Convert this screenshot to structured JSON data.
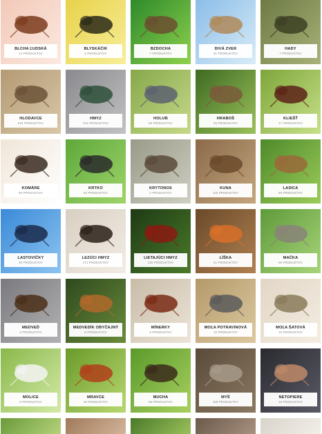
{
  "products_suffix": "PRODUKTOV",
  "categories": [
    {
      "name": "BLCHA ĽUDSKÁ",
      "count": "14",
      "icon": "flea-photo",
      "bg1": "#f2c9b8",
      "bg2": "#fbe9e0",
      "fg": "#7a3a1c"
    },
    {
      "name": "BLYSKÁČIK",
      "count": "5",
      "icon": "pollen-beetle-photo",
      "bg1": "#e8d24a",
      "bg2": "#f7ee9a",
      "fg": "#2b2a18"
    },
    {
      "name": "BZDOCHA",
      "count": "7",
      "icon": "bedbug-photo",
      "bg1": "#2d8a2a",
      "bg2": "#8fd14e",
      "fg": "#6b4f2f"
    },
    {
      "name": "DIVÁ ZVER",
      "count": "51",
      "icon": "deer-photo",
      "bg1": "#8bbde8",
      "bg2": "#d9ecf7",
      "fg": "#b08a5a"
    },
    {
      "name": "HADY",
      "count": "7",
      "icon": "snake-photo",
      "bg1": "#6e7a44",
      "bg2": "#a8b27a",
      "fg": "#3c3f22"
    },
    {
      "name": "HLODAVCE",
      "count": "516",
      "icon": "mouse-photo",
      "bg1": "#b49a74",
      "bg2": "#d8c7a8",
      "fg": "#6b5238"
    },
    {
      "name": "HMYZ",
      "count": "194",
      "icon": "insects-photo",
      "bg1": "#8a8a8e",
      "bg2": "#c2c2c4",
      "fg": "#2e4f3a"
    },
    {
      "name": "HOLUB",
      "count": "69",
      "icon": "pigeon-photo",
      "bg1": "#87a84a",
      "bg2": "#c6d98a",
      "fg": "#5d6170"
    },
    {
      "name": "HRABOŠ",
      "count": "45",
      "icon": "vole-photo",
      "bg1": "#3e6a22",
      "bg2": "#9ac15a",
      "fg": "#7a5a3a"
    },
    {
      "name": "KLIEŠŤ",
      "count": "17",
      "icon": "tick-photo",
      "bg1": "#7ea63a",
      "bg2": "#c8e08a",
      "fg": "#5c2218"
    },
    {
      "name": "KOMÁRE",
      "count": "56",
      "icon": "mosquito-photo",
      "bg1": "#f0e6d8",
      "bg2": "#ffffff",
      "fg": "#3a2a20"
    },
    {
      "name": "KRTKO",
      "count": "63",
      "icon": "mole-photo",
      "bg1": "#5ea83a",
      "bg2": "#9fd46a",
      "fg": "#2a2a2a"
    },
    {
      "name": "KRYTONOS",
      "count": "4",
      "icon": "weevil-photo",
      "bg1": "#9a9a8a",
      "bg2": "#cfcfc2",
      "fg": "#5a4a3a"
    },
    {
      "name": "KUNA",
      "count": "116",
      "icon": "marten-photo",
      "bg1": "#8a6a4a",
      "bg2": "#c4a67e",
      "fg": "#6a4a2a"
    },
    {
      "name": "LASICA",
      "count": "69",
      "icon": "weasel-photo",
      "bg1": "#4e8a2a",
      "bg2": "#9ccc5a",
      "fg": "#9a6a3a"
    },
    {
      "name": "LASTOVIČKY",
      "count": "40",
      "icon": "swallow-photo",
      "bg1": "#3a8ad8",
      "bg2": "#8cc4f0",
      "fg": "#1a2a4a"
    },
    {
      "name": "LEZÚCI HMYZ",
      "count": "171",
      "icon": "crawling-insects-photo",
      "bg1": "#d8cfc2",
      "bg2": "#f2ece4",
      "fg": "#2a2018"
    },
    {
      "name": "LIETAJÚCI HMYZ",
      "count": "136",
      "icon": "fly-photo",
      "bg1": "#1e3a14",
      "bg2": "#4a7a2a",
      "fg": "#8a1a12"
    },
    {
      "name": "LÍŠKA",
      "count": "41",
      "icon": "fox-photo",
      "bg1": "#6a4a2a",
      "bg2": "#b08050",
      "fg": "#d8702a"
    },
    {
      "name": "MAČKA",
      "count": "69",
      "icon": "cat-photo",
      "bg1": "#5e9a3a",
      "bg2": "#a8d47a",
      "fg": "#8a8478"
    },
    {
      "name": "MEDVEĎ",
      "count": "4",
      "icon": "bear-photo",
      "bg1": "#7a7a7e",
      "bg2": "#b2b2b4",
      "fg": "#4a2e18"
    },
    {
      "name": "MEDVEDÍK OBYČAJNÝ",
      "count": "8",
      "icon": "mole-cricket-photo",
      "bg1": "#2e4a1e",
      "bg2": "#6a8a3a",
      "fg": "#b06a2a"
    },
    {
      "name": "MÍNERKY",
      "count": "5",
      "icon": "leafminer-photo",
      "bg1": "#c8bca8",
      "bg2": "#ece4d8",
      "fg": "#7a2a14"
    },
    {
      "name": "MOĽA POTRAVINOVÁ",
      "count": "15",
      "icon": "pantry-moth-photo",
      "bg1": "#b49a6a",
      "bg2": "#dcc8a0",
      "fg": "#5a5a5a"
    },
    {
      "name": "MOĽA ŠATOVÁ",
      "count": "15",
      "icon": "clothes-moth-photo",
      "bg1": "#e2d6c6",
      "bg2": "#f4ede2",
      "fg": "#8a7a5a"
    },
    {
      "name": "MOLICE",
      "count": "5",
      "icon": "whitefly-photo",
      "bg1": "#8ab84a",
      "bg2": "#d4eaa8",
      "fg": "#f4f4f4"
    },
    {
      "name": "MRAVCE",
      "count": "45",
      "icon": "ant-photo",
      "bg1": "#6a9a2a",
      "bg2": "#b8d870",
      "fg": "#b0401a"
    },
    {
      "name": "MUCHA",
      "count": "55",
      "icon": "housefly-photo",
      "bg1": "#5a9a2a",
      "bg2": "#a8d060",
      "fg": "#3a2a1a"
    },
    {
      "name": "MYŠ",
      "count": "168",
      "icon": "house-mouse-photo",
      "bg1": "#5a4a3a",
      "bg2": "#8a7a62",
      "fg": "#a89a8a"
    },
    {
      "name": "NETOPIERE",
      "count": "18",
      "icon": "bat-photo",
      "bg1": "#2a2a30",
      "bg2": "#5a5a66",
      "fg": "#c08a6a"
    }
  ],
  "next_row": [
    {
      "icon": "partial-tile-1",
      "bg1": "#6a9a3a",
      "bg2": "#b4d27a"
    },
    {
      "icon": "partial-tile-2",
      "bg1": "#a07a5a",
      "bg2": "#d2b49a"
    },
    {
      "icon": "partial-tile-3",
      "bg1": "#4a7a2a",
      "bg2": "#9ac05a"
    },
    {
      "icon": "partial-tile-4",
      "bg1": "#6a5a4a",
      "bg2": "#a89080"
    },
    {
      "icon": "partial-tile-5",
      "bg1": "#d8d4cc",
      "bg2": "#f2efe8"
    }
  ]
}
